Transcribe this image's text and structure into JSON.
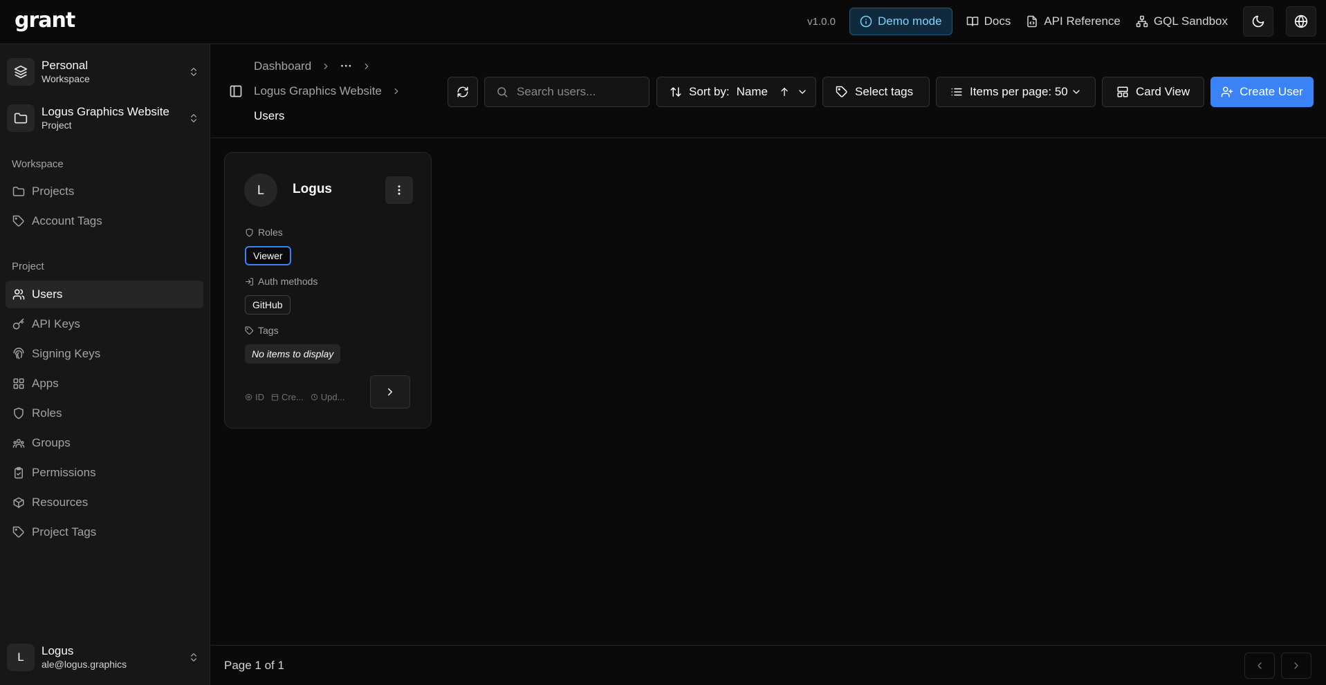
{
  "topbar": {
    "logo": "grant",
    "version": "v1.0.0",
    "demo_mode": "Demo mode",
    "links": [
      {
        "label": "Docs",
        "icon": "book-icon"
      },
      {
        "label": "API Reference",
        "icon": "file-code-icon"
      },
      {
        "label": "GQL Sandbox",
        "icon": "sitemap-icon"
      }
    ]
  },
  "sidebar": {
    "workspace_switcher": {
      "name": "Personal",
      "type": "Workspace"
    },
    "project_switcher": {
      "name": "Logus Graphics Website",
      "type": "Project"
    },
    "workspace_label": "Workspace",
    "workspace_items": [
      {
        "label": "Projects",
        "icon": "folder-icon"
      },
      {
        "label": "Account Tags",
        "icon": "tag-icon"
      }
    ],
    "project_label": "Project",
    "project_items": [
      {
        "label": "Users",
        "icon": "users-icon",
        "active": true
      },
      {
        "label": "API Keys",
        "icon": "key-icon"
      },
      {
        "label": "Signing Keys",
        "icon": "fingerprint-icon"
      },
      {
        "label": "Apps",
        "icon": "grid-icon"
      },
      {
        "label": "Roles",
        "icon": "shield-icon"
      },
      {
        "label": "Groups",
        "icon": "groups-icon"
      },
      {
        "label": "Permissions",
        "icon": "clipboard-check-icon"
      },
      {
        "label": "Resources",
        "icon": "box-icon"
      },
      {
        "label": "Project Tags",
        "icon": "tag-icon"
      }
    ],
    "user": {
      "initial": "L",
      "name": "Logus",
      "email": "ale@logus.graphics"
    }
  },
  "breadcrumb": {
    "dashboard": "Dashboard",
    "ellipsis": "···",
    "project": "Logus Graphics Website",
    "current": "Users"
  },
  "toolbar": {
    "search_placeholder": "Search users...",
    "sort_prefix": "Sort by:",
    "sort_value": "Name",
    "select_tags": "Select tags",
    "items_per_page": "Items per page: 50",
    "view": "Card View",
    "create": "Create User"
  },
  "users": [
    {
      "initial": "L",
      "name": "Logus",
      "roles_label": "Roles",
      "roles": [
        "Viewer"
      ],
      "auth_label": "Auth methods",
      "auth_methods": [
        "GitHub"
      ],
      "tags_label": "Tags",
      "tags_empty": "No items to display",
      "meta_id": "ID",
      "meta_created": "Cre...",
      "meta_updated": "Upd..."
    }
  ],
  "pagination": {
    "text": "Page 1 of 1"
  },
  "colors": {
    "accent": "#3b82f6",
    "background": "#0a0a0a",
    "sidebar": "#171717"
  }
}
